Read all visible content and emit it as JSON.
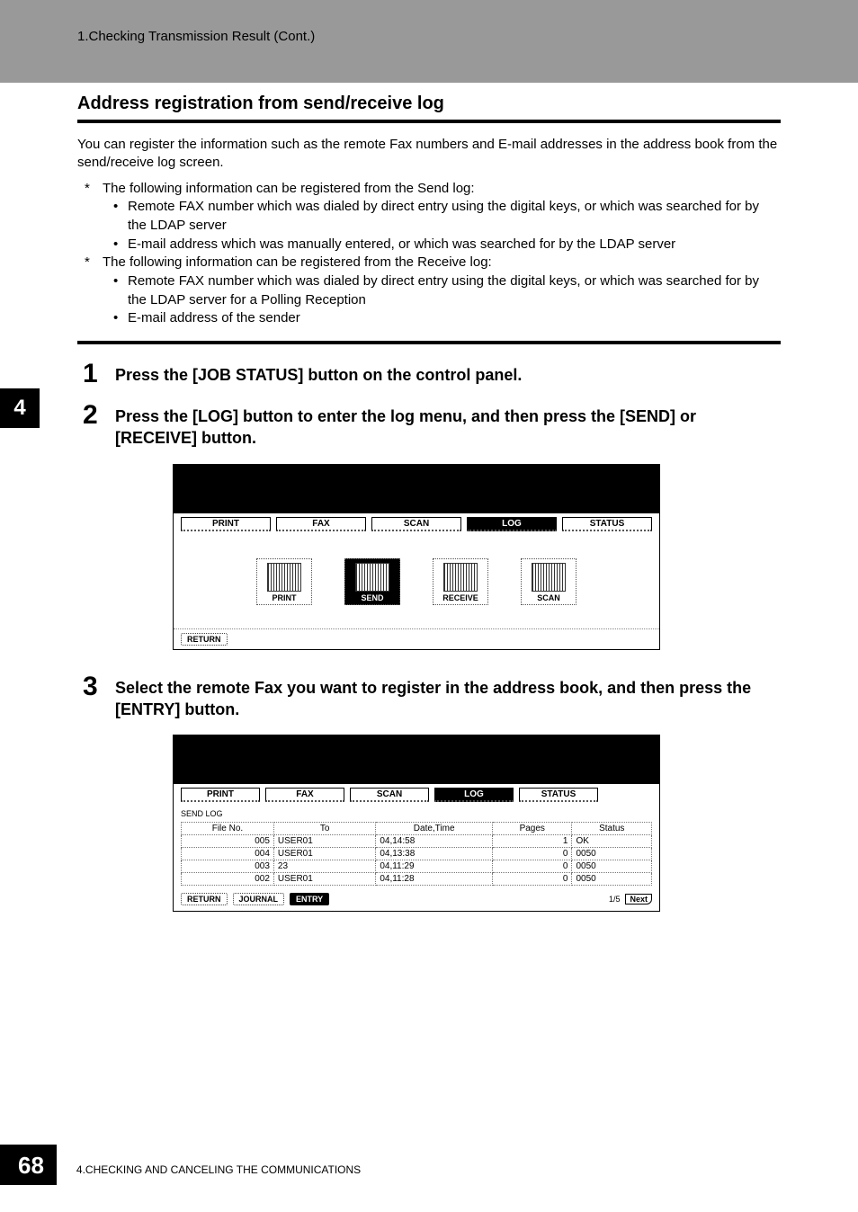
{
  "header": {
    "breadcrumb": "1.Checking Transmission Result (Cont.)"
  },
  "chapter_tab": "4",
  "page_number": "68",
  "footer_text": "4.CHECKING AND CANCELING THE COMMUNICATIONS",
  "section": {
    "title": "Address registration from send/receive log",
    "intro": "You can register the information such as the remote Fax numbers and E-mail addresses in the address book from the send/receive log screen.",
    "bullets": [
      {
        "text": "The following information can be registered from the Send log:",
        "subs": [
          "Remote FAX number which was dialed by direct entry using the digital keys, or which was searched for by the LDAP server",
          "E-mail address which was manually entered, or which was searched for by the LDAP server"
        ]
      },
      {
        "text": "The following information can be registered from the Receive log:",
        "subs": [
          "Remote FAX number which was dialed by direct entry using the digital keys, or which was searched for by the LDAP server for a Polling Reception",
          "E-mail address of the sender"
        ]
      }
    ]
  },
  "steps": [
    {
      "num": "1",
      "text": "Press the [JOB STATUS] button on the control panel."
    },
    {
      "num": "2",
      "text": "Press the [LOG] button to enter the log menu, and then press the [SEND] or [RECEIVE] button."
    },
    {
      "num": "3",
      "text": "Select the remote Fax you want to register in the address book, and then press the [ENTRY] button."
    }
  ],
  "screen1": {
    "tabs": [
      "PRINT",
      "FAX",
      "SCAN",
      "LOG",
      "STATUS"
    ],
    "active_tab": "LOG",
    "icons": [
      "PRINT",
      "SEND",
      "RECEIVE",
      "SCAN"
    ],
    "return_label": "RETURN"
  },
  "screen2": {
    "tabs": [
      "PRINT",
      "FAX",
      "SCAN",
      "LOG",
      "STATUS"
    ],
    "active_tab": "LOG",
    "list_title": "SEND LOG",
    "columns": [
      "File No.",
      "To",
      "Date,Time",
      "Pages",
      "Status"
    ],
    "rows": [
      {
        "file_no": "005",
        "to": "USER01",
        "datetime": "04,14:58",
        "pages": "1",
        "status": "OK"
      },
      {
        "file_no": "004",
        "to": "USER01",
        "datetime": "04,13:38",
        "pages": "0",
        "status": "0050"
      },
      {
        "file_no": "003",
        "to": "23",
        "datetime": "04,11:29",
        "pages": "0",
        "status": "0050"
      },
      {
        "file_no": "002",
        "to": "USER01",
        "datetime": "04,11:28",
        "pages": "0",
        "status": "0050"
      }
    ],
    "buttons": {
      "return": "RETURN",
      "journal": "JOURNAL",
      "entry": "ENTRY"
    },
    "pager": "1/5",
    "next": "Next"
  }
}
